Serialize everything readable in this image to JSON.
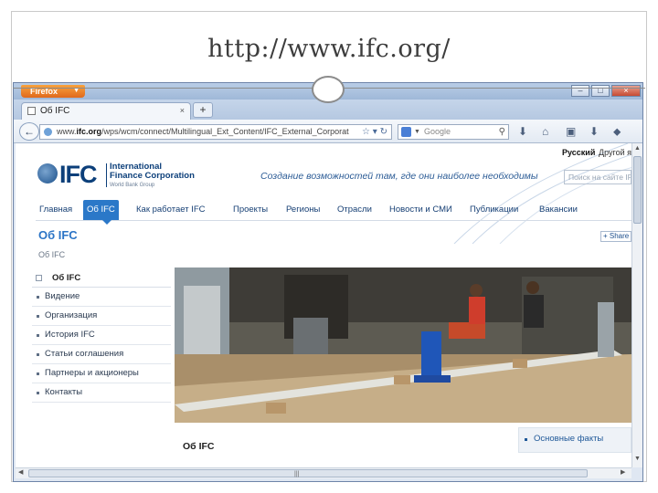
{
  "slide": {
    "title": "http://www.ifc.org/"
  },
  "browser": {
    "app_button": "Firefox",
    "window_controls": {
      "minimize": "–",
      "maximize": "□",
      "close": "×"
    },
    "tab": {
      "title": "Об IFC",
      "close": "×"
    },
    "new_tab": "+",
    "url": {
      "prefix": "www.",
      "host": "ifc.org",
      "path": "/wps/wcm/connect/Multilingual_Ext_Content/IFC_External_Corporat"
    },
    "search": {
      "engine": "Google",
      "placeholder": "Google"
    },
    "toolbar_icons": [
      "bookmark-star-icon",
      "download-icon",
      "home-icon",
      "bookmarks-icon",
      "addon-icon",
      "firefox-menu-icon"
    ]
  },
  "site": {
    "languages": {
      "current": "Русский",
      "other": "Другой я"
    },
    "logo": {
      "mark": "IFC",
      "line1": "International",
      "line2": "Finance Corporation",
      "subline": "World Bank Group"
    },
    "tagline": "Создание возможностей там, где они наиболее необходимы",
    "search_placeholder": "Поиск на сайте IFC",
    "nav": [
      "Главная",
      "Об IFC",
      "Как работает IFC",
      "Проекты",
      "Регионы",
      "Отрасли",
      "Новости и СМИ",
      "Публикации",
      "Вакансии"
    ],
    "nav_active_index": 1,
    "page_title": "Об IFC",
    "share_label": "+ Share",
    "breadcrumb": "Об IFC",
    "sidenav": {
      "header": "Об IFC",
      "items": [
        "Видение",
        "Организация",
        "История IFC",
        "Статьи соглашения",
        "Партнеры и акционеры",
        "Контакты"
      ]
    },
    "hero_alt": "Workshop",
    "caption_title": "Об IFC",
    "fast_facts": "Основные факты"
  },
  "colors": {
    "brand_blue": "#0c3f7a",
    "nav_active": "#2b78c8",
    "title_blue": "#2b74c6"
  }
}
